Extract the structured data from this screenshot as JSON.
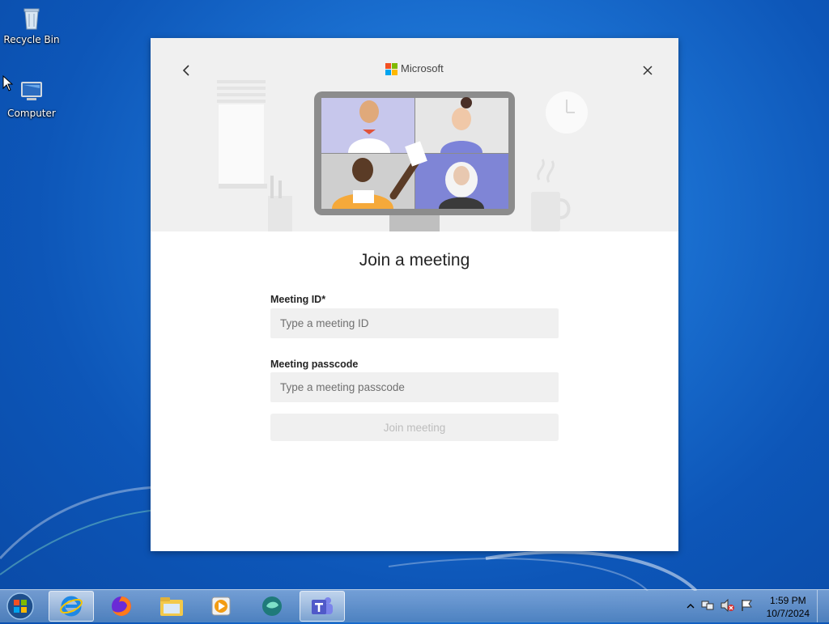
{
  "desktop": {
    "icons": [
      {
        "label": "Recycle Bin"
      },
      {
        "label": "Computer"
      }
    ]
  },
  "dialog": {
    "brand": "Microsoft",
    "title": "Join a meeting",
    "meeting_id": {
      "label": "Meeting ID*",
      "placeholder": "Type a meeting ID",
      "value": ""
    },
    "passcode": {
      "label": "Meeting passcode",
      "placeholder": "Type a meeting passcode",
      "value": ""
    },
    "join_button": "Join meeting",
    "join_enabled": false
  },
  "taskbar": {
    "pinned": [
      "internet-explorer-icon",
      "firefox-icon",
      "file-explorer-icon",
      "media-player-icon",
      "chat-app-icon",
      "teams-icon"
    ],
    "active": "teams-icon"
  },
  "clock": {
    "time": "1:59 PM",
    "date": "10/7/2024"
  },
  "colors": {
    "ms_red": "#f25022",
    "ms_green": "#7fba00",
    "ms_blue": "#00a4ef",
    "ms_yellow": "#ffb900",
    "teams_purple": "#5059c9",
    "desktop_blue": "#1a6fd0"
  }
}
